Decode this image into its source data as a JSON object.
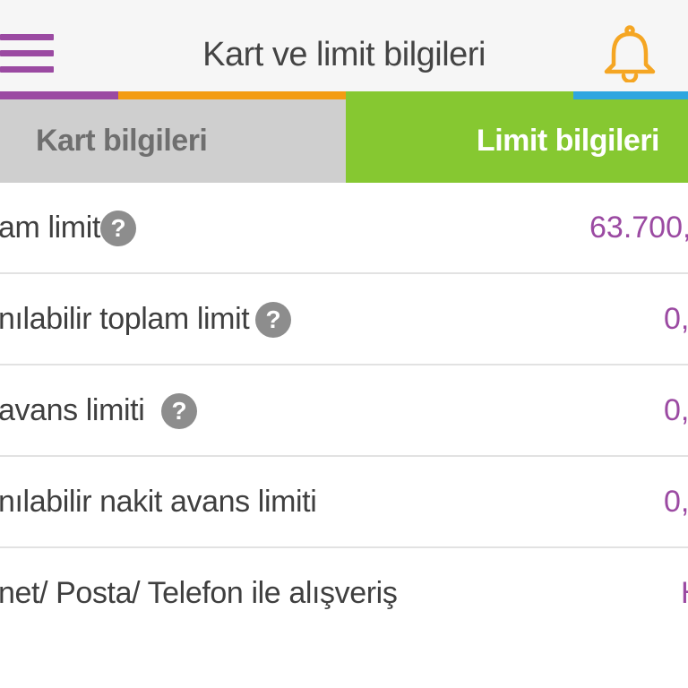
{
  "header": {
    "title": "Kart ve limit bilgileri",
    "menu_icon": "hamburger-menu-icon",
    "notification_icon": "bell-icon"
  },
  "color_strip": [
    "#9b4aa2",
    "#f39c12",
    "#86c831",
    "#2ea6e0"
  ],
  "tabs": [
    {
      "label": "Kart bilgileri",
      "active": false
    },
    {
      "label": "Limit bilgileri",
      "active": true
    }
  ],
  "rows": [
    {
      "label": "am limit",
      "has_help": true,
      "value": "63.700,"
    },
    {
      "label": "nılabilir toplam limit",
      "has_help": true,
      "value": "0,"
    },
    {
      "label": " avans limiti",
      "has_help": true,
      "value": "0,"
    },
    {
      "label": "nılabilir nakit avans limiti",
      "has_help": false,
      "value": "0,"
    },
    {
      "label": "net/ Posta/ Telefon ile alışveriş",
      "has_help": false,
      "value": "H"
    }
  ],
  "help_glyph": "?",
  "colors": {
    "accent_purple": "#9b4aa2",
    "bell_orange": "#f5a623",
    "active_tab_green": "#86c831",
    "inactive_tab_gray": "#cfcfcf"
  }
}
